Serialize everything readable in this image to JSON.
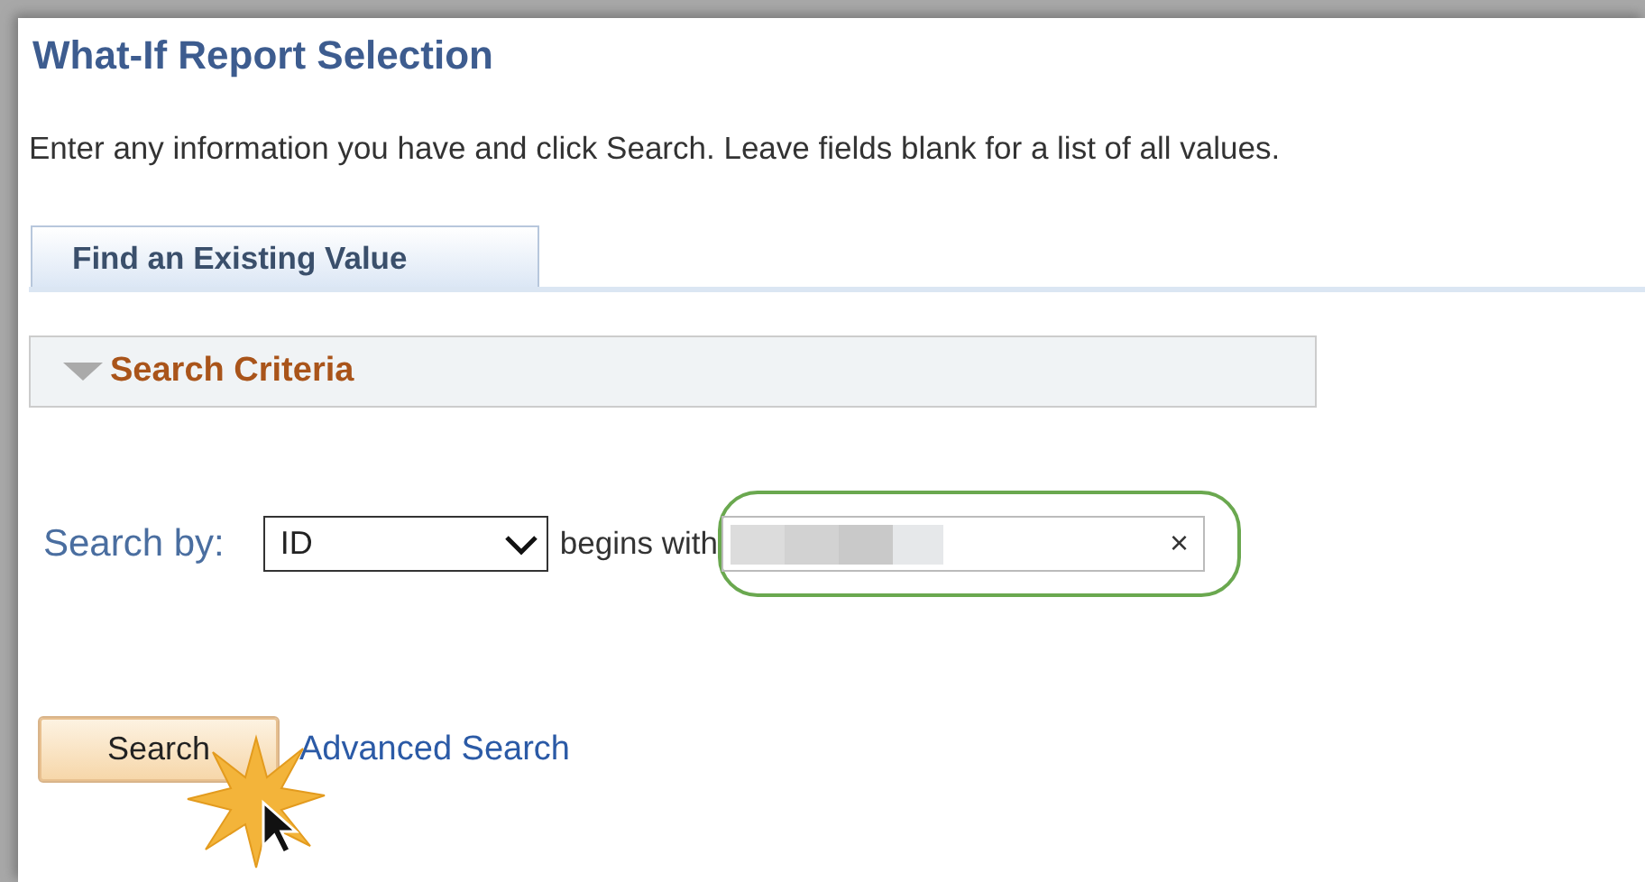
{
  "page": {
    "title": "What-If Report Selection",
    "instructions": "Enter any information you have and click Search. Leave fields blank for a list of all values."
  },
  "tabs": [
    {
      "label": "Find an Existing Value",
      "selected": true
    }
  ],
  "section": {
    "title": "Search Criteria",
    "expanded": true
  },
  "search": {
    "label": "Search by:",
    "field": "ID",
    "operator": "begins with",
    "clear": "×",
    "highlighted": true
  },
  "buttons": [
    {
      "kind": "button",
      "label": "Search",
      "clicked": true
    },
    {
      "kind": "link",
      "label": "Advanced Search",
      "clicked": false
    }
  ]
}
